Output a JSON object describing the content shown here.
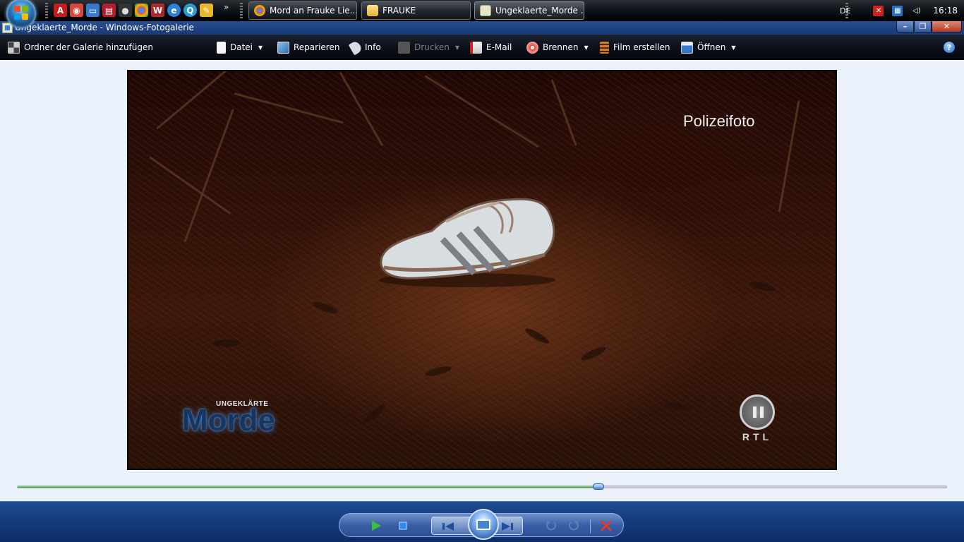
{
  "taskbar": {
    "windows": [
      {
        "label": "Mord an Frauke Lie...",
        "icon": "chrome-icon"
      },
      {
        "label": "FRAUKE",
        "icon": "folder-icon"
      },
      {
        "label": "Ungeklaerte_Morde ...",
        "icon": "photo-gallery-icon"
      }
    ],
    "overflow_label": "»",
    "language": "DE",
    "clock": "16:18"
  },
  "window": {
    "title": "Ungeklaerte_Morde - Windows-Fotogalerie",
    "minimize_label": "–",
    "maximize_label": "❐",
    "close_label": "✕"
  },
  "toolbar": {
    "add_folder": "Ordner der Galerie hinzufügen",
    "file": "Datei",
    "repair": "Reparieren",
    "info": "Info",
    "print": "Drucken",
    "email": "E-Mail",
    "burn": "Brennen",
    "movie": "Film erstellen",
    "open": "Öffnen",
    "help": "?"
  },
  "photo": {
    "caption": "Polizeifoto",
    "logo_small": "UNGEKLÄRTE",
    "logo_big": "Morde",
    "channel": "RTL"
  },
  "playback": {
    "progress": 0.625
  },
  "colors": {
    "accent": "#1f4a92",
    "progress_fill": "#2ea52b",
    "viewer_background": "#ecf2fb",
    "delete": "#e03a2e"
  }
}
